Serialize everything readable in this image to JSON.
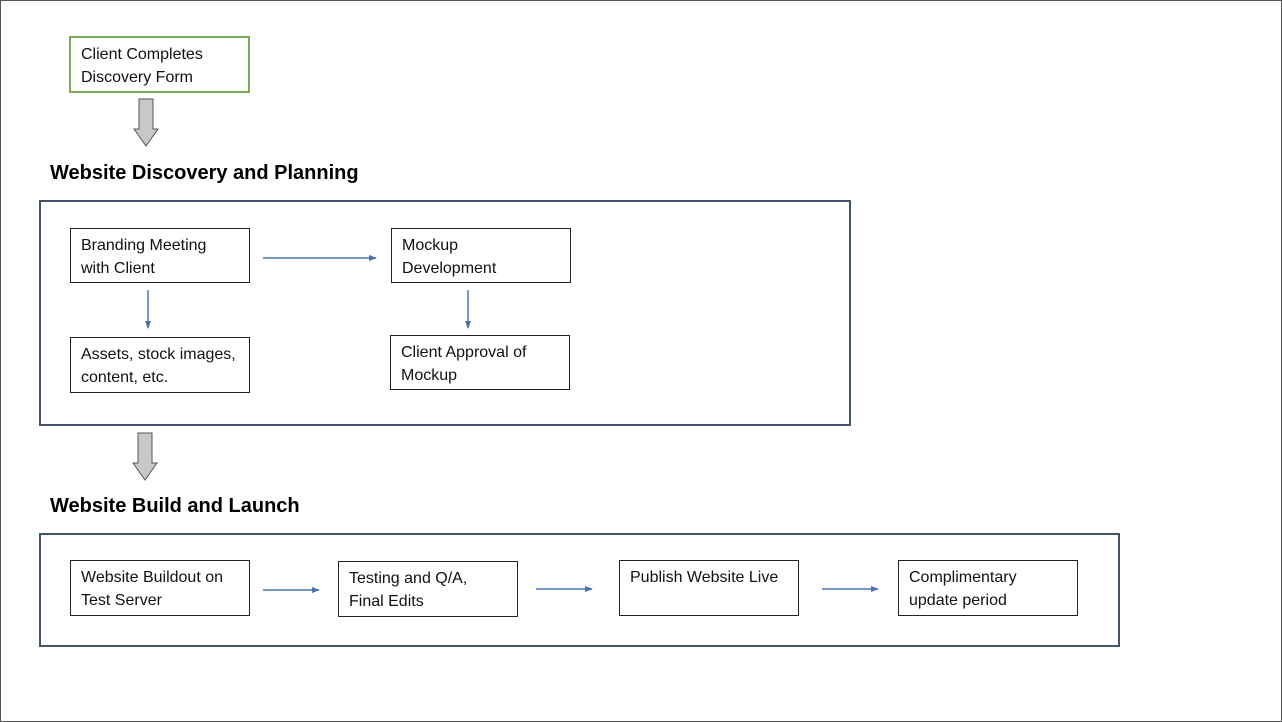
{
  "start": {
    "label": "Client Completes\nDiscovery Form"
  },
  "sections": [
    {
      "heading": "Website Discovery and Planning",
      "steps": [
        {
          "label": "Branding Meeting\nwith Client"
        },
        {
          "label": "Mockup\nDevelopment"
        },
        {
          "label": "Assets, stock images,\ncontent, etc."
        },
        {
          "label": "Client Approval of\nMockup"
        }
      ]
    },
    {
      "heading": "Website Build and Launch",
      "steps": [
        {
          "label": "Website Buildout on\nTest Server"
        },
        {
          "label": "Testing and Q/A,\nFinal Edits"
        },
        {
          "label": "Publish Website Live"
        },
        {
          "label": "Complimentary\nupdate period"
        }
      ]
    }
  ],
  "colors": {
    "start_border": "#7aa957",
    "container_border": "#44546a",
    "arrow": "#4a72b0",
    "block_arrow_fill": "#c8c8c8"
  }
}
